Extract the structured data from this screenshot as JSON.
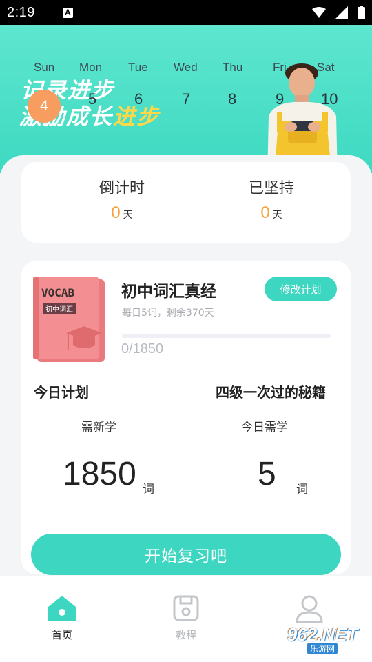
{
  "status_bar": {
    "time": "2:19"
  },
  "banner": {
    "slogan_line1": "记录进步",
    "slogan_line2_a": "激励成长",
    "slogan_line2_b": "进步",
    "week_days": [
      "Sun",
      "Mon",
      "Tue",
      "Wed",
      "Thu",
      "Fri",
      "Sat"
    ],
    "dates": [
      "4",
      "5",
      "6",
      "7",
      "8",
      "9",
      "10"
    ],
    "today_index": 0
  },
  "countdown": {
    "left_title": "倒计时",
    "left_value": "0",
    "right_title": "已坚持",
    "right_value": "0",
    "unit": "天"
  },
  "plan": {
    "book_cover_title": "VOCAB",
    "book_cover_tag": "初中词汇",
    "book_name": "初中词汇真经",
    "book_sub": "每日5词，剩余370天",
    "modify_label": "修改计划",
    "progress_text": "0/1850",
    "progress_fraction": 0,
    "left_title": "今日计划",
    "right_title": "四级一次过的秘籍",
    "new_label": "需新学",
    "new_value": "1850",
    "today_label": "今日需学",
    "today_value": "5",
    "word_unit": "词",
    "start_label": "开始复习吧"
  },
  "nav": {
    "home": "首页",
    "tutorial": "教程"
  },
  "watermark": {
    "top": "962.NET",
    "bottom": "乐游网"
  },
  "colors": {
    "accent": "#3dd6c0",
    "orange": "#f5a33b",
    "today": "#f79d60"
  }
}
